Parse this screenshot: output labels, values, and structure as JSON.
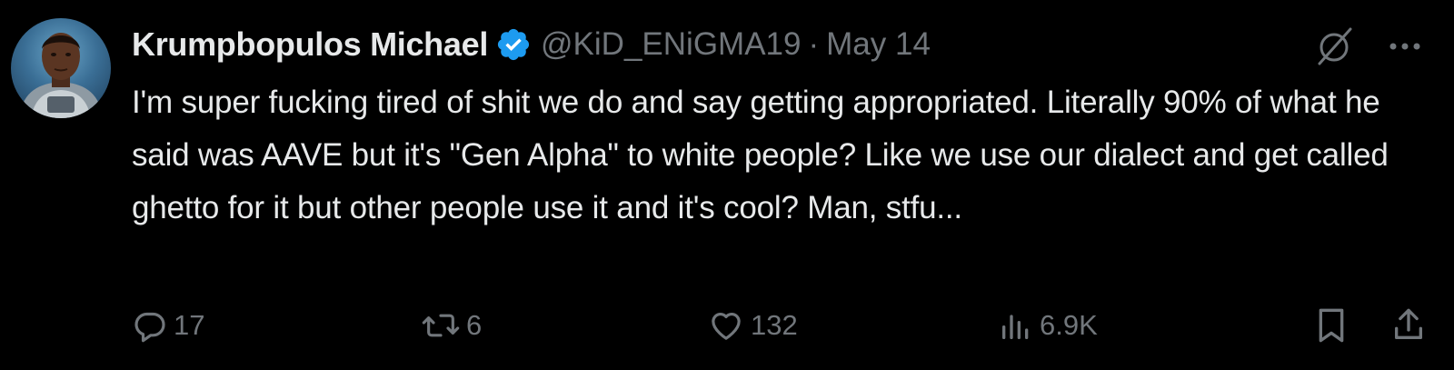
{
  "author": {
    "display_name": "Krumpbopulos Michael",
    "handle": "@KiD_ENiGMA19",
    "separator": "·",
    "date": "May 14",
    "verified": true
  },
  "tweet": {
    "text": "I'm super fucking tired of shit we do and say getting appropriated. Literally 90% of what he said was AAVE but it's \"Gen Alpha\" to white people? Like we use our dialect and get called ghetto for it but other people use it and it's cool? Man, stfu..."
  },
  "actions": {
    "replies": "17",
    "retweets": "6",
    "likes": "132",
    "views": "6.9K"
  },
  "icons": {
    "verified": "verified-badge-icon",
    "grok": "grok-icon",
    "more": "more-icon",
    "reply": "reply-icon",
    "retweet": "retweet-icon",
    "like": "heart-icon",
    "views": "views-icon",
    "bookmark": "bookmark-icon",
    "share": "share-icon"
  },
  "colors": {
    "background": "#000000",
    "text": "#e7e9ea",
    "muted": "#71767b",
    "verified": "#1d9bf0"
  }
}
